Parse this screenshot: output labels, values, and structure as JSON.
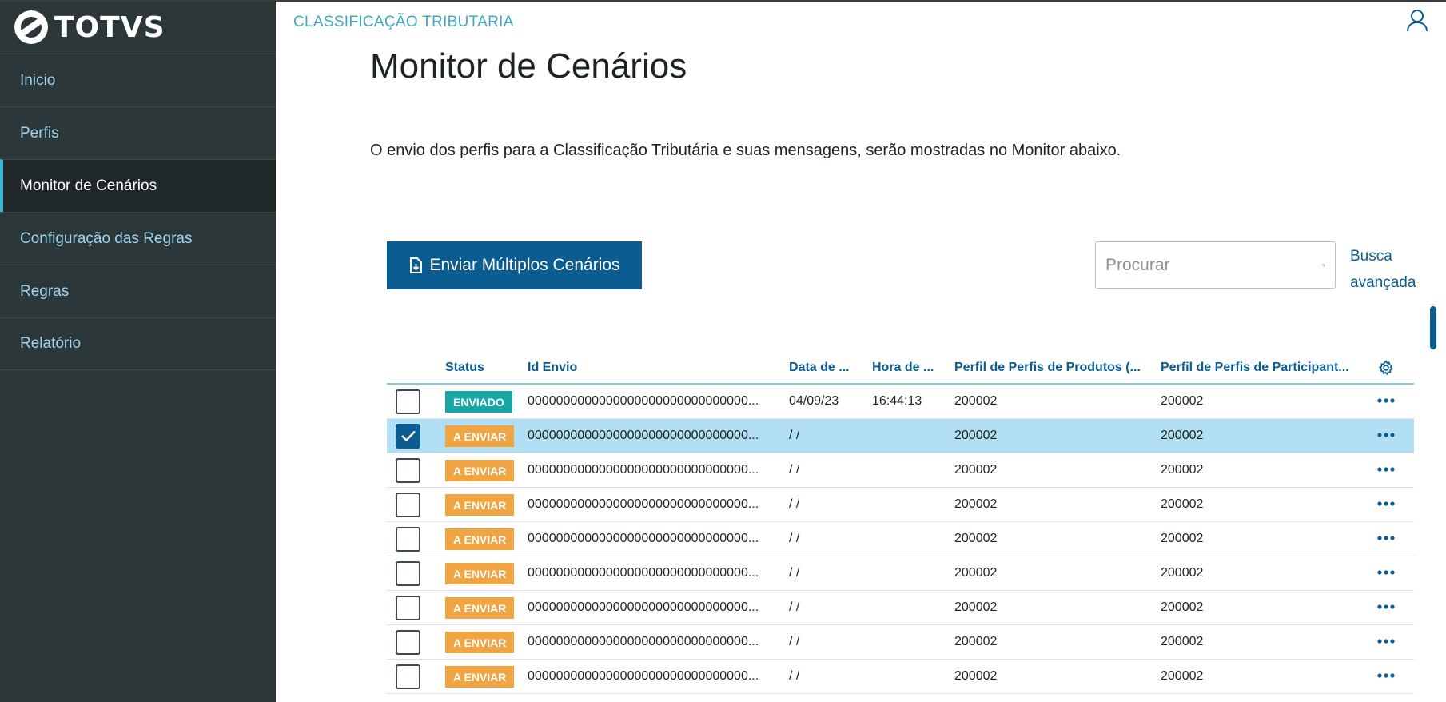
{
  "app": {
    "logo_text": "TOTVS"
  },
  "header": {
    "breadcrumb": "CLASSIFICAÇÃO TRIBUTARIA"
  },
  "sidebar": {
    "items": [
      {
        "label": "Inicio",
        "active": false
      },
      {
        "label": "Perfis",
        "active": false
      },
      {
        "label": "Monitor de Cenários",
        "active": true
      },
      {
        "label": "Configuração das Regras",
        "active": false
      },
      {
        "label": "Regras",
        "active": false
      },
      {
        "label": "Relatório",
        "active": false
      }
    ]
  },
  "main": {
    "title": "Monitor de Cenários",
    "description": "O envio dos perfis para a Classificação Tributária e suas mensagens, serão mostradas no Monitor abaixo.",
    "send_button_label": "Enviar Múltiplos Cenários",
    "search_placeholder": "Procurar",
    "advanced_search_label": "Busca avançada"
  },
  "table": {
    "columns": [
      "Status",
      "Id Envio",
      "Data de ...",
      "Hora de ...",
      "Perfil de Perfis de Produtos (...",
      "Perfil de Perfis de Participant..."
    ],
    "rows": [
      {
        "checked": false,
        "status": "ENVIADO",
        "status_color": "#1aa6a6",
        "id": "0000000000000000000000000000000...",
        "data": "04/09/23",
        "hora": "16:44:13",
        "produtos": "200002",
        "participantes": "200002"
      },
      {
        "checked": true,
        "status": "A ENVIAR",
        "status_color": "#f0a542",
        "id": "0000000000000000000000000000000...",
        "data": "/ /",
        "hora": "",
        "produtos": "200002",
        "participantes": "200002"
      },
      {
        "checked": false,
        "status": "A ENVIAR",
        "status_color": "#f0a542",
        "id": "0000000000000000000000000000000...",
        "data": "/ /",
        "hora": "",
        "produtos": "200002",
        "participantes": "200002"
      },
      {
        "checked": false,
        "status": "A ENVIAR",
        "status_color": "#f0a542",
        "id": "0000000000000000000000000000000...",
        "data": "/ /",
        "hora": "",
        "produtos": "200002",
        "participantes": "200002"
      },
      {
        "checked": false,
        "status": "A ENVIAR",
        "status_color": "#f0a542",
        "id": "0000000000000000000000000000000...",
        "data": "/ /",
        "hora": "",
        "produtos": "200002",
        "participantes": "200002"
      },
      {
        "checked": false,
        "status": "A ENVIAR",
        "status_color": "#f0a542",
        "id": "0000000000000000000000000000000...",
        "data": "/ /",
        "hora": "",
        "produtos": "200002",
        "participantes": "200002"
      },
      {
        "checked": false,
        "status": "A ENVIAR",
        "status_color": "#f0a542",
        "id": "0000000000000000000000000000000...",
        "data": "/ /",
        "hora": "",
        "produtos": "200002",
        "participantes": "200002"
      },
      {
        "checked": false,
        "status": "A ENVIAR",
        "status_color": "#f0a542",
        "id": "0000000000000000000000000000000...",
        "data": "/ /",
        "hora": "",
        "produtos": "200002",
        "participantes": "200002"
      },
      {
        "checked": false,
        "status": "A ENVIAR",
        "status_color": "#f0a542",
        "id": "0000000000000000000000000000000...",
        "data": "/ /",
        "hora": "",
        "produtos": "200002",
        "participantes": "200002"
      }
    ]
  },
  "colors": {
    "sidebar_bg": "#2c3739",
    "primary": "#0b5d91",
    "accent": "#3fb4ce",
    "selected_row": "#b3dff5"
  },
  "icons": [
    "user-icon",
    "search-icon",
    "gear-icon",
    "more-icon",
    "upload-file-icon",
    "check-icon"
  ]
}
